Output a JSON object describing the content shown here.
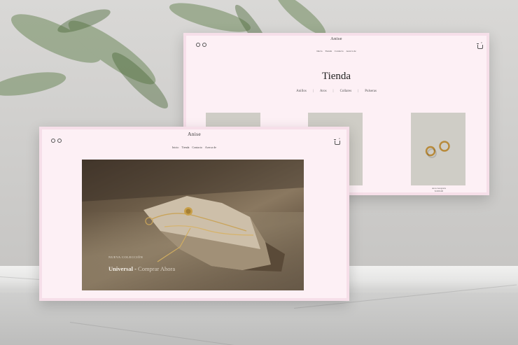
{
  "back_window": {
    "logo": "Anise",
    "nav": [
      "Inicio",
      "Tienda",
      "Contacto",
      "Acerca de"
    ],
    "cart_count": "0",
    "page_title": "Tienda",
    "categories": [
      "Anillos",
      "Aros",
      "Collares",
      "Pulseras"
    ],
    "product_caption": "Aros Gregoria",
    "product_price": "$ 000.00"
  },
  "front_window": {
    "logo": "Anise",
    "nav": [
      "Inicio",
      "Tienda",
      "Contacto",
      "Acerca de"
    ],
    "cart_count": "0",
    "hero_tag": "NUEVA COLECCIÓN",
    "hero_collection": "Universal -",
    "hero_cta": "Comprar Ahora"
  },
  "colors": {
    "page_background": "#fdf0f5",
    "window_border": "#f6dfe9",
    "product_placeholder": "#cfcdc6"
  }
}
